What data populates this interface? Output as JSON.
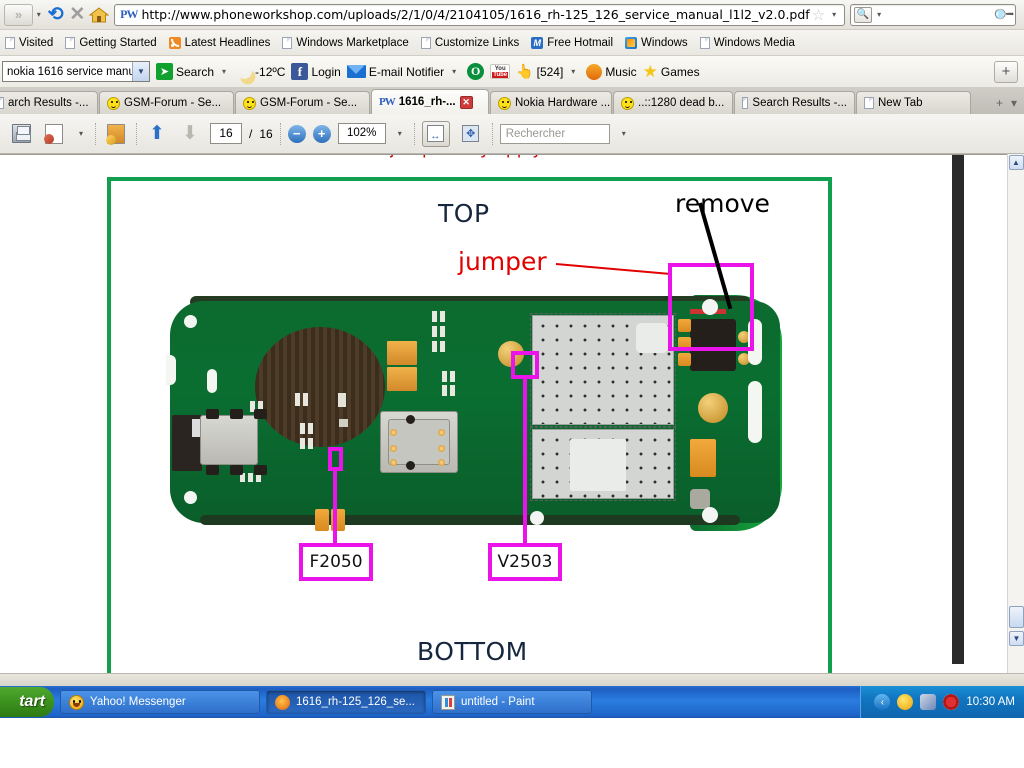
{
  "browser": {
    "url": "http://www.phoneworkshop.com/uploads/2/1/0/4/2104105/1616_rh-125_126_service_manual_l1l2_v2.0.pdf",
    "url_favicon_label": "PW",
    "search_placeholder": "",
    "nav": {
      "back_forward_label": "»",
      "reload_icon": "reload-icon",
      "stop_icon": "stop-icon",
      "home_icon": "home-icon",
      "bookmark_star_icon": "star-icon",
      "search_magnifier_icon": "search-icon"
    },
    "bookmarks": [
      {
        "label": "Visited",
        "icon": "folder-icon"
      },
      {
        "label": "Getting Started",
        "icon": "document-icon"
      },
      {
        "label": "Latest Headlines",
        "icon": "rss-icon"
      },
      {
        "label": "Windows Marketplace",
        "icon": "document-icon"
      },
      {
        "label": "Customize Links",
        "icon": "document-icon"
      },
      {
        "label": "Free Hotmail",
        "icon": "hotmail-icon"
      },
      {
        "label": "Windows",
        "icon": "windows-icon"
      },
      {
        "label": "Windows Media",
        "icon": "document-icon"
      }
    ],
    "addon_toolbar": {
      "search_field_value": "nokia 1616 service manua",
      "search_button_label": "Search",
      "weather_label": "-12ºC",
      "facebook_label": "Login",
      "email_notifier_label": "E-mail Notifier",
      "counter_label": "[524]",
      "music_label": "Music",
      "games_label": "Games",
      "add_button_label": "+"
    },
    "tabs": [
      {
        "label": "arch Results -...",
        "icon": "page-icon",
        "active": false,
        "closable": false
      },
      {
        "label": "GSM-Forum - Se...",
        "icon": "smiley-icon",
        "active": false,
        "closable": false
      },
      {
        "label": "GSM-Forum - Se...",
        "icon": "smiley-icon",
        "active": false,
        "closable": false
      },
      {
        "label": "1616_rh-...",
        "icon": "pw-icon",
        "active": true,
        "closable": true
      },
      {
        "label": "Nokia Hardware ...",
        "icon": "smiley-icon",
        "active": false,
        "closable": false
      },
      {
        "label": "..::1280 dead b...",
        "icon": "smiley-icon",
        "active": false,
        "closable": false
      },
      {
        "label": "Search Results -...",
        "icon": "page-icon",
        "active": false,
        "closable": false
      },
      {
        "label": "New Tab",
        "icon": "document-icon",
        "active": false,
        "closable": false
      }
    ],
    "tabbar_right": {
      "new_tab_label": "+",
      "list_all_label": "▾"
    }
  },
  "pdf_toolbar": {
    "save_icon": "save-icon",
    "print_icon": "print-icon",
    "print_caret": "▾",
    "email_icon": "email-document-icon",
    "prev_page_icon": "arrow-up-icon",
    "next_page_icon": "arrow-down-icon",
    "current_page": "16",
    "page_separator": "/",
    "total_pages": "16",
    "zoom_out_label": "−",
    "zoom_in_label": "+",
    "zoom_level": "102%",
    "zoom_caret": "▾",
    "fit_width_icon": "fit-width-icon",
    "fit_page_icon": "fit-page-icon",
    "find_placeholder": "Rechercher",
    "find_caret": "▾"
  },
  "document": {
    "clipped_heading": "jumper way apply",
    "labels": {
      "top": "TOP",
      "bottom": "BOTTOM",
      "jumper": "jumper",
      "remove": "remove",
      "component_f2050": "F2050",
      "component_v2503": "V2503"
    },
    "colors": {
      "frame_green": "#11a050",
      "annotation_magenta": "#ea13ea",
      "jumper_red": "#e20000",
      "label_dark": "#16263f",
      "pcb_green": "#0a6e31"
    }
  },
  "taskbar": {
    "start_label": "tart",
    "items": [
      {
        "label": "Yahoo! Messenger",
        "icon": "yahoo-messenger-icon",
        "active": false
      },
      {
        "label": "1616_rh-125_126_se...",
        "icon": "firefox-icon",
        "active": true
      },
      {
        "label": "untitled - Paint",
        "icon": "paint-icon",
        "active": false
      }
    ],
    "tray": {
      "chevron_label": "‹",
      "icons": [
        "messenger-tray-icon",
        "network-tray-icon",
        "antivirus-tray-icon"
      ],
      "clock": "10:30 AM"
    }
  },
  "scrollbar": {
    "up_label": "▲",
    "down_label": "▼"
  }
}
